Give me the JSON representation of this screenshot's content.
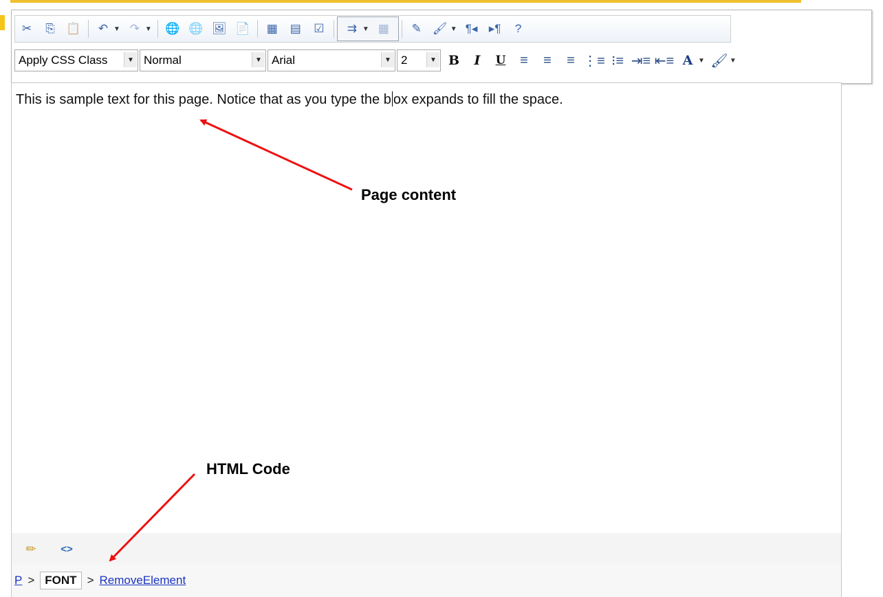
{
  "colors": {
    "annotation_arrow": "#ee1111",
    "link": "#1a33c0"
  },
  "toolbar_row1": {
    "buttons": [
      {
        "name": "cut-icon",
        "glyph": "✂",
        "disabled": false
      },
      {
        "name": "copy-icon",
        "glyph": "⎘",
        "disabled": false
      },
      {
        "name": "paste-icon",
        "glyph": "📋",
        "disabled": true
      },
      {
        "name": "undo-icon",
        "glyph": "↶",
        "disabled": false,
        "dropdown": true
      },
      {
        "name": "redo-icon",
        "glyph": "↷",
        "disabled": true,
        "dropdown": true
      },
      {
        "name": "hyperlink-icon",
        "glyph": "🌐",
        "disabled": false
      },
      {
        "name": "remove-link-icon",
        "glyph": "🌐",
        "disabled": true
      },
      {
        "name": "insert-image-icon",
        "glyph": "🖼",
        "disabled": false
      },
      {
        "name": "insert-object-icon",
        "glyph": "📄",
        "disabled": false
      },
      {
        "name": "insert-table-icon",
        "glyph": "▦",
        "disabled": false
      },
      {
        "name": "table-properties-icon",
        "glyph": "▤",
        "disabled": false
      },
      {
        "name": "form-element-icon",
        "glyph": "☑",
        "disabled": false
      }
    ],
    "group_buttons": [
      {
        "name": "insert-snippet-icon",
        "glyph": "⇉",
        "disabled": false,
        "dropdown": true
      },
      {
        "name": "insert-symbol-icon",
        "glyph": "▦",
        "disabled": true
      }
    ],
    "buttons_after": [
      {
        "name": "format-code-icon",
        "glyph": "✎",
        "disabled": false
      },
      {
        "name": "format-stripper-icon",
        "glyph": "🖌",
        "disabled": false,
        "dropdown": true
      },
      {
        "name": "paragraph-ltr-icon",
        "glyph": "¶◂",
        "disabled": false
      },
      {
        "name": "paragraph-rtl-icon",
        "glyph": "▸¶",
        "disabled": false
      },
      {
        "name": "help-icon",
        "glyph": "?",
        "disabled": false
      }
    ]
  },
  "toolbar_row2": {
    "css_class": "Apply CSS Class",
    "paragraph_style": "Normal",
    "font_name": "Arial",
    "font_size": "2",
    "bold": "B",
    "italic": "I",
    "underline": "U",
    "icons": [
      {
        "name": "align-left-icon",
        "glyph": "≡"
      },
      {
        "name": "align-center-icon",
        "glyph": "≡"
      },
      {
        "name": "align-right-icon",
        "glyph": "≡"
      },
      {
        "name": "numbered-list-icon",
        "glyph": "⋮≡"
      },
      {
        "name": "bulleted-list-icon",
        "glyph": "⁝≡"
      },
      {
        "name": "indent-icon",
        "glyph": "⇥≡"
      },
      {
        "name": "outdent-icon",
        "glyph": "⇤≡"
      }
    ],
    "fore_color": "A",
    "back_color_glyph": "🖌"
  },
  "editor": {
    "text_before_caret": "This is sample text for this page.  Notice that as you type the b",
    "text_after_caret": "ox expands to fill the space."
  },
  "annotations": {
    "page_content": "Page content",
    "html_code": "HTML Code"
  },
  "mode_buttons": [
    {
      "name": "design-mode-icon",
      "glyph": "✏"
    },
    {
      "name": "html-mode-icon",
      "glyph": "<>"
    }
  ],
  "tag_path": {
    "p": "P",
    "font": "FONT",
    "remove": "RemoveElement",
    "sep": ">"
  }
}
